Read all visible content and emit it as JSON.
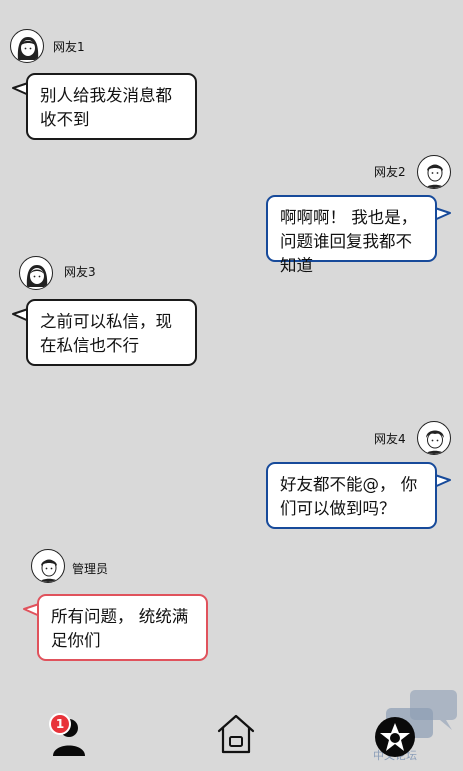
{
  "messages": [
    {
      "user": "网友1",
      "text": "别人给我发消息都收不到"
    },
    {
      "user": "网友2",
      "text": "啊啊啊！ 我也是， 问题谁回复我都不知道"
    },
    {
      "user": "网友3",
      "text": "之前可以私信，现在私信也不行"
    },
    {
      "user": "网友4",
      "text": "好友都不能@， 你们可以做到吗？"
    },
    {
      "user": "管理员",
      "text": "所有问题， 统统满足你们"
    }
  ],
  "colors": {
    "background": "#d9d9d9",
    "bubble_border_default": "#1a1a1a",
    "bubble_border_blue": "#174a9a",
    "bubble_border_red": "#e0525c",
    "badge": "#e8333a"
  },
  "nav": {
    "user_badge_count": "1",
    "icons": [
      "user-icon",
      "home-icon",
      "star-icon"
    ]
  },
  "watermark": {
    "text": "中文论坛"
  }
}
